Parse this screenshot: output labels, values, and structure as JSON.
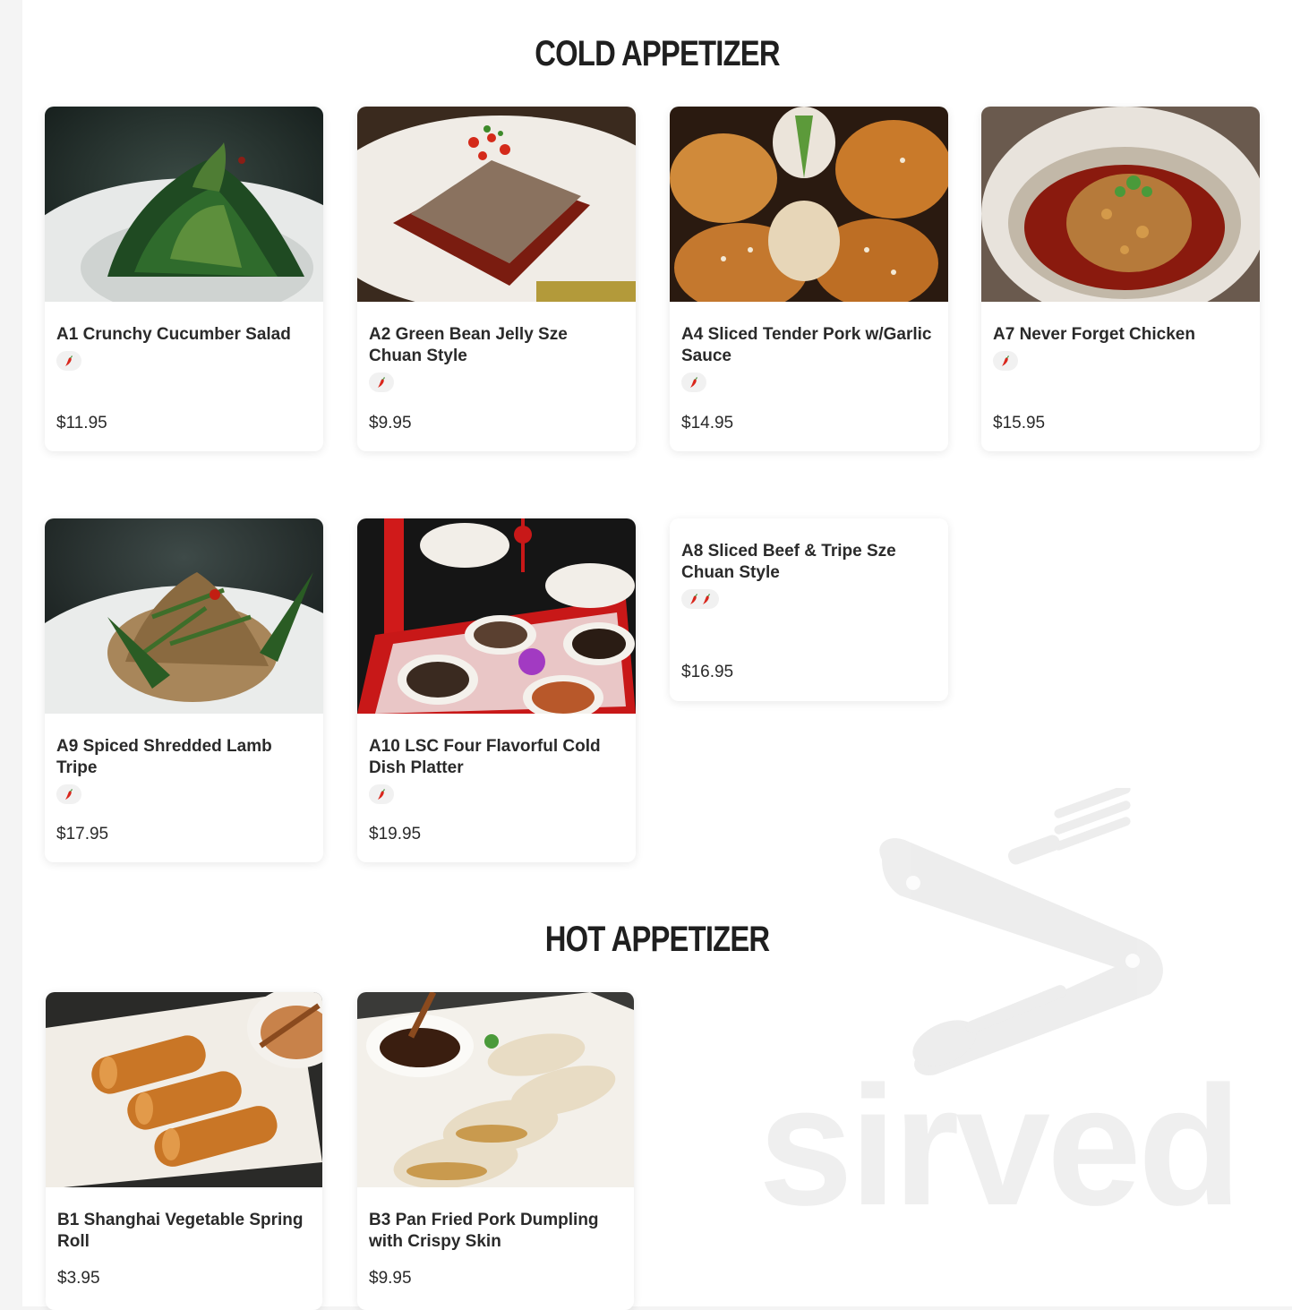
{
  "brand_watermark": "sirved",
  "sections": [
    {
      "title": "COLD APPETIZER",
      "items": [
        {
          "name": "A1 Crunchy Cucumber Salad",
          "price": "$11.95",
          "spice": 1,
          "image": "cucumber-salad"
        },
        {
          "name": "A2 Green Bean Jelly Sze Chuan Style",
          "price": "$9.95",
          "spice": 1,
          "image": "bean-jelly"
        },
        {
          "name": "A4 Sliced Tender Pork w/Garlic Sauce",
          "price": "$14.95",
          "spice": 1,
          "image": "pork-garlic"
        },
        {
          "name": "A7 Never Forget Chicken",
          "price": "$15.95",
          "spice": 1,
          "image": "chili-chicken"
        },
        {
          "name": "A9 Spiced Shredded Lamb Tripe",
          "price": "$17.95",
          "spice": 1,
          "image": "lamb-tripe"
        },
        {
          "name": "A10 LSC Four Flavorful Cold Dish Platter",
          "price": "$19.95",
          "spice": 1,
          "image": "cold-platter"
        },
        {
          "name": "A8 Sliced Beef & Tripe Sze Chuan Style",
          "price": "$16.95",
          "spice": 2,
          "image": null
        }
      ]
    },
    {
      "title": "HOT APPETIZER",
      "items": [
        {
          "name": "B1 Shanghai Vegetable Spring Roll",
          "price": "$3.95",
          "spice": 0,
          "image": "spring-roll"
        },
        {
          "name": "B3 Pan Fried Pork Dumpling with Crispy Skin",
          "price": "$9.95",
          "spice": 0,
          "image": "pork-dumpling"
        }
      ]
    }
  ],
  "colors": {
    "page_bg": "#f4f4f4",
    "card_bg": "#ffffff",
    "chili_red": "#d9261c",
    "chili_green": "#3a8a2e"
  }
}
